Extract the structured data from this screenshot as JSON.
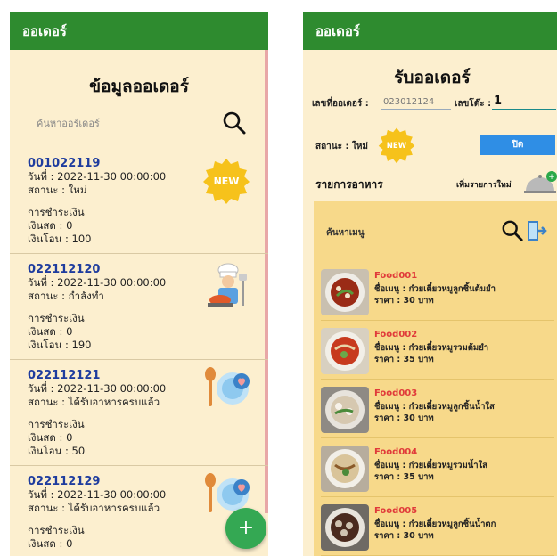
{
  "left": {
    "appbar_title": "ออเดอร์",
    "page_title": "ข้อมูลออเดอร์",
    "search_placeholder": "ค้นหาออร์เดอร์",
    "orders": [
      {
        "id": "001022119",
        "date": "วันที่ : 2022-11-30 00:00:00",
        "status": "สถานะ : ใหม่",
        "pay_label": "การชำระเงิน",
        "cash": "เงินสด : 0",
        "transfer": "เงินโอน : 100",
        "icon": "new-badge-icon",
        "badge_text": "NEW"
      },
      {
        "id": "022112120",
        "date": "วันที่ : 2022-11-30 00:00:00",
        "status": "สถานะ : กำลังทำ",
        "pay_label": "การชำระเงิน",
        "cash": "เงินสด : 0",
        "transfer": "เงินโอน : 190",
        "icon": "chef-cooking-icon"
      },
      {
        "id": "022112121",
        "date": "วันที่ : 2022-11-30 00:00:00",
        "status": "สถานะ : ได้รับอาหารครบแล้ว",
        "pay_label": "การชำระเงิน",
        "cash": "เงินสด : 0",
        "transfer": "เงินโอน : 50",
        "icon": "plate-spoon-icon"
      },
      {
        "id": "022112129",
        "date": "วันที่ : 2022-11-30 00:00:00",
        "status": "สถานะ : ได้รับอาหารครบแล้ว",
        "pay_label": "การชำระเงิน",
        "cash": "เงินสด : 0",
        "transfer": "",
        "icon": "plate-spoon-icon"
      }
    ],
    "fab_label": "+"
  },
  "right": {
    "appbar_title": "ออเดอร์",
    "page_title": "รับออเดอร์",
    "order_no_label": "เลขที่ออเดอร์ :",
    "order_no_value": "023012124",
    "table_label": "เลขโต๊ะ :",
    "table_value": "1",
    "status_label": "สถานะ : ใหม่",
    "badge_text": "NEW",
    "close_button": "ปิด",
    "food_list_title": "รายการอาหาร",
    "add_item_label": "เพิ่มรายการใหม่",
    "menu_search_placeholder": "ค้นหาเมนู",
    "menu": [
      {
        "code": "Food001",
        "name": "ชื่อเมนู : ก๋วยเตี๋ยวหมูลูกชิ้นต้มยำ",
        "price": "ราคา : 30 บาท"
      },
      {
        "code": "Food002",
        "name": "ชื่อเมนู : ก๋วยเตี๋ยวหมูรวมต้มยำ",
        "price": "ราคา : 35 บาท"
      },
      {
        "code": "Food003",
        "name": "ชื่อเมนู : ก๋วยเตี๋ยวหมูลูกชิ้นน้ำใส",
        "price": "ราคา : 30 บาท"
      },
      {
        "code": "Food004",
        "name": "ชื่อเมนู : ก๋วยเตี๋ยวหมูรวมน้ำใส",
        "price": "ราคา : 35 บาท"
      },
      {
        "code": "Food005",
        "name": "ชื่อเมนู : ก๋วยเตี๋ยวหมูลูกชิ้นน้ำตก",
        "price": "ราคา : 30 บาท"
      }
    ]
  },
  "colors": {
    "appbar": "#2e8b2f",
    "background": "#fcefcf",
    "order_id": "#1e3c9e",
    "food_code": "#e03a3a",
    "close_button": "#2f8ee5",
    "fab": "#34a853",
    "menu_panel": "#f7d98a"
  }
}
